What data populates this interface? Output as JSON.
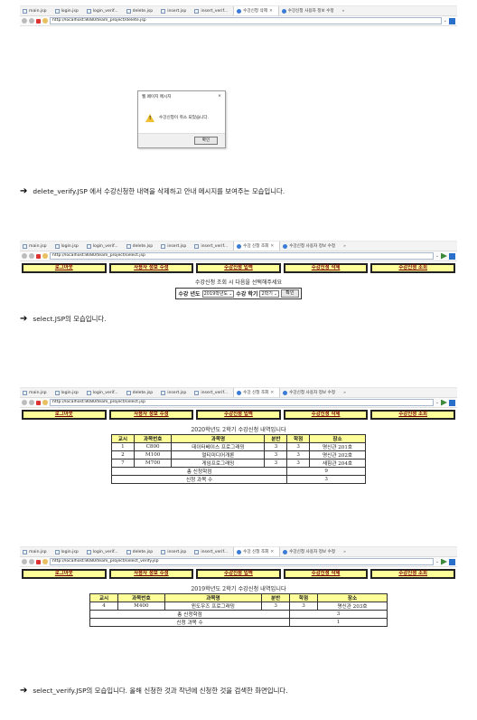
{
  "shot1": {
    "tabs": [
      "main.jsp",
      "login.jsp",
      "login_verif...",
      "delete.jsp",
      "insert.jsp",
      "insert_verif...",
      "수강신청 삭제",
      "수강신청 사용자 정보 수정"
    ],
    "url": "http://localhost:8080/team_project/delete.jsp"
  },
  "dialog": {
    "title": "웹 페이지 메시지",
    "close": "×",
    "message": "수강신청이 취소 되었습니다.",
    "ok": "확인"
  },
  "caption1": "delete_verify.JSP 에서 수강신청한 내역을 삭제하고 안내 메시지를 보여주는 모습입니다.",
  "menu": [
    "로그아웃",
    "사용자 정보 수정",
    "수강신청 입력",
    "수강신청 삭제",
    "수강신청 조회"
  ],
  "shot2": {
    "tabs": [
      "main.jsp",
      "login.jsp",
      "login_verif...",
      "delete.jsp",
      "insert.jsp",
      "insert_verif...",
      "수강 신청 조회",
      "수강신청 사용자 정보 수정"
    ],
    "url": "http://localhost:8080/team_project/select.jsp",
    "prompt": "수강신청 조회 시 다음을 선택해주세요",
    "year_label": "수강 년도",
    "year_value": "2019학년도",
    "term_label": "수강 학기",
    "term_value": "2학기",
    "confirm": "확인"
  },
  "caption2": "select.JSP의 모습입니다.",
  "shot3": {
    "tabs": [
      "main.jsp",
      "login.jsp",
      "login_verif...",
      "delete.jsp",
      "insert.jsp",
      "insert_verif...",
      "수강 신청 조회",
      "수강신청 사용자 정보 수정"
    ],
    "url": "http://localhost:8080/team_project/select.jsp",
    "title": "2020학년도 2학기 수강신청 내역입니다",
    "headers": [
      "교시",
      "과목번호",
      "과목명",
      "분반",
      "학점",
      "장소"
    ],
    "rows": [
      [
        "1",
        "C800",
        "데이터베이스 프로그래밍",
        "3",
        "3",
        "명신관 201호"
      ],
      [
        "2",
        "M100",
        "멀티미디어개론",
        "3",
        "3",
        "명신관 202호"
      ],
      [
        "7",
        "M700",
        "게임프로그래밍",
        "3",
        "3",
        "새힘관 204호"
      ]
    ],
    "total_label": "총 신청학점",
    "total_value": "9",
    "count_label": "신청 과목 수",
    "count_value": "3"
  },
  "shot4": {
    "tabs": [
      "main.jsp",
      "login.jsp",
      "login_verif...",
      "delete.jsp",
      "insert.jsp",
      "insert_verif...",
      "수강 신청 조회",
      "수강신청 사용자 정보 수정"
    ],
    "url": "http://localhost:8080/team_project/select_verify.jsp",
    "title": "2019학년도 2학기 수강신청 내역입니다",
    "headers": [
      "교시",
      "과목번호",
      "과목명",
      "분반",
      "학점",
      "장소"
    ],
    "rows": [
      [
        "4",
        "M400",
        "윈도우즈 프로그래밍",
        "3",
        "3",
        "명신관 203호"
      ]
    ],
    "total_label": "총 신청학점",
    "total_value": "3",
    "count_label": "신청 과목 수",
    "count_value": "1"
  },
  "caption3": "select_verify.JSP의 모습입니다. 올해 신청한 것과 작년에 신청한 것을 검색한 화면입니다."
}
